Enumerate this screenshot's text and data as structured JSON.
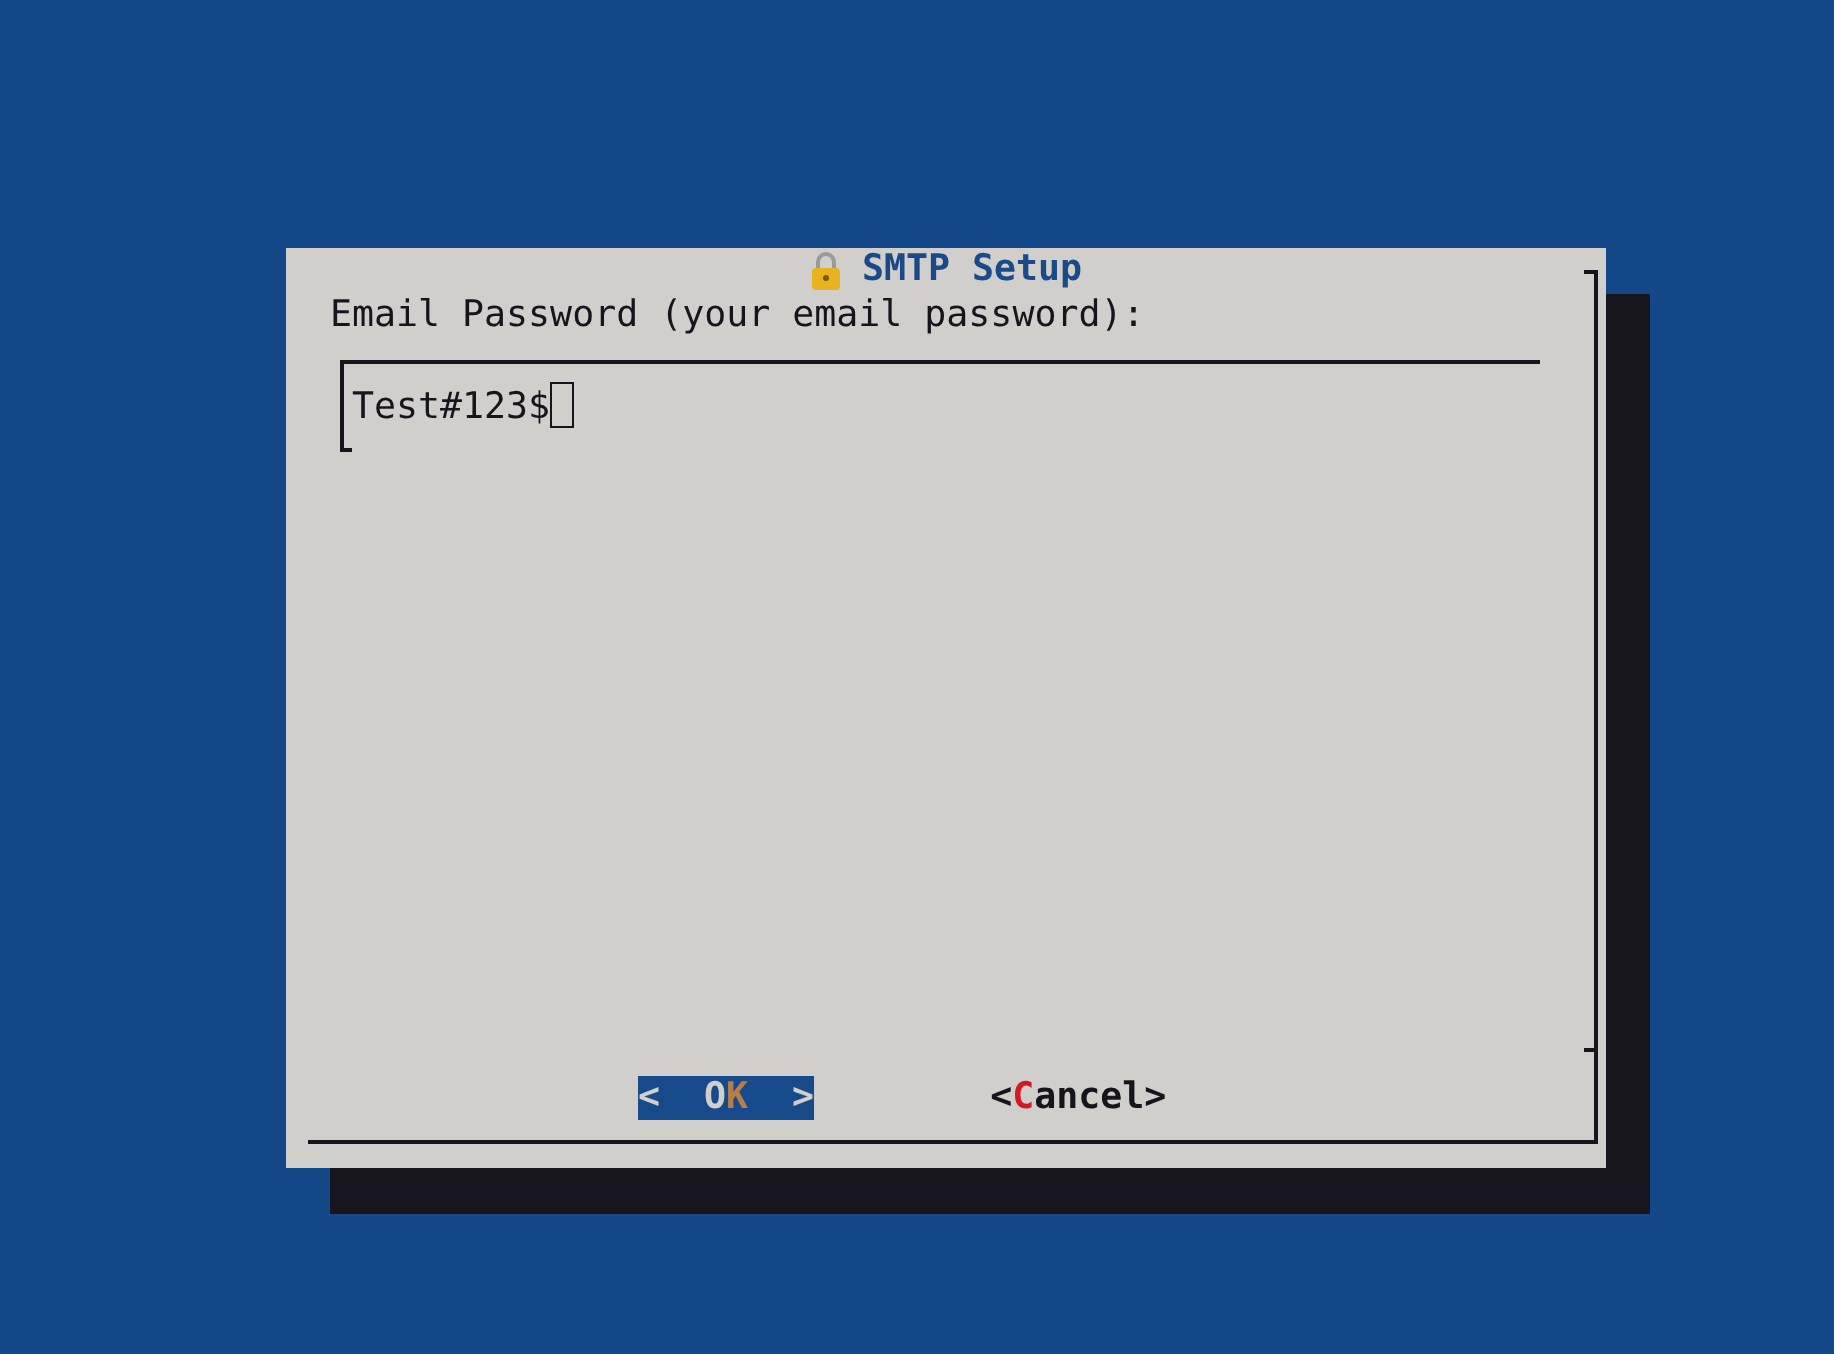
{
  "dialog": {
    "title": "SMTP Setup",
    "prompt": "Email Password (your email password):",
    "input": {
      "value": "Test#123$"
    },
    "buttons": [
      {
        "before": "<  O",
        "hotkey": "K",
        "after": "  >",
        "selected": true
      },
      {
        "before": "<",
        "hotkey": "C",
        "after": "ancel>",
        "selected": false
      }
    ]
  }
}
